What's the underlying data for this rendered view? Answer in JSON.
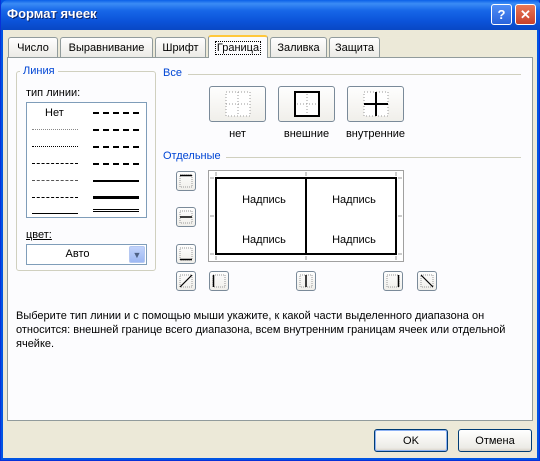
{
  "window": {
    "title": "Формат ячеек",
    "help_button": "?",
    "close_button": "✕"
  },
  "tabs": [
    {
      "label": "Число",
      "active": false
    },
    {
      "label": "Выравнивание",
      "active": false
    },
    {
      "label": "Шрифт",
      "active": false
    },
    {
      "label": "Граница",
      "active": true
    },
    {
      "label": "Заливка",
      "active": false
    },
    {
      "label": "Защита",
      "active": false
    }
  ],
  "line_group": {
    "title": "Линия",
    "style_label": "тип линии:",
    "none_label": "Нет",
    "color_label": "цвет:",
    "color_value": "Авто"
  },
  "presets": {
    "title": "Все",
    "items": [
      {
        "label": "нет",
        "icon": "border-none-icon"
      },
      {
        "label": "внешние",
        "icon": "border-outline-icon"
      },
      {
        "label": "внутренние",
        "icon": "border-inside-icon"
      }
    ]
  },
  "borders": {
    "title": "Отдельные",
    "preview_cells": [
      "Надпись",
      "Надпись",
      "Надпись",
      "Надпись"
    ]
  },
  "description": "Выберите тип линии и с помощью мыши укажите, к какой части выделенного диапазона он относится: внешней границе всего диапазона, всем внутренним границам ячеек или отдельной ячейке.",
  "buttons": {
    "ok": "OK",
    "cancel": "Отмена"
  }
}
